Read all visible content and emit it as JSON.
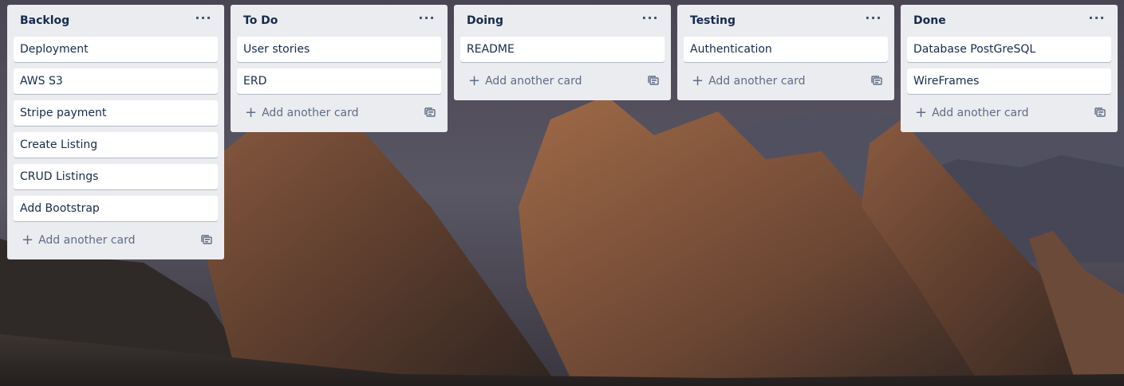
{
  "icons": {
    "list_menu": "more-horizontal-icon",
    "add": "plus-icon",
    "template": "card-template-icon"
  },
  "colors": {
    "list_bg": "#ebecf0",
    "card_bg": "#ffffff",
    "title": "#172b4d",
    "muted": "#5e6c84"
  },
  "lists": [
    {
      "title": "Backlog",
      "menu": "···",
      "cards": [
        "Deployment",
        "AWS S3",
        "Stripe payment",
        "Create Listing",
        "CRUD Listings",
        "Add Bootstrap"
      ],
      "add_label": "Add another card"
    },
    {
      "title": "To Do",
      "menu": "···",
      "cards": [
        "User stories",
        "ERD"
      ],
      "add_label": "Add another card"
    },
    {
      "title": "Doing",
      "menu": "···",
      "cards": [
        "README"
      ],
      "add_label": "Add another card"
    },
    {
      "title": "Testing",
      "menu": "···",
      "cards": [
        "Authentication"
      ],
      "add_label": "Add another card"
    },
    {
      "title": "Done",
      "menu": "···",
      "cards": [
        "Database PostGreSQL",
        "WireFrames"
      ],
      "add_label": "Add another card"
    }
  ]
}
